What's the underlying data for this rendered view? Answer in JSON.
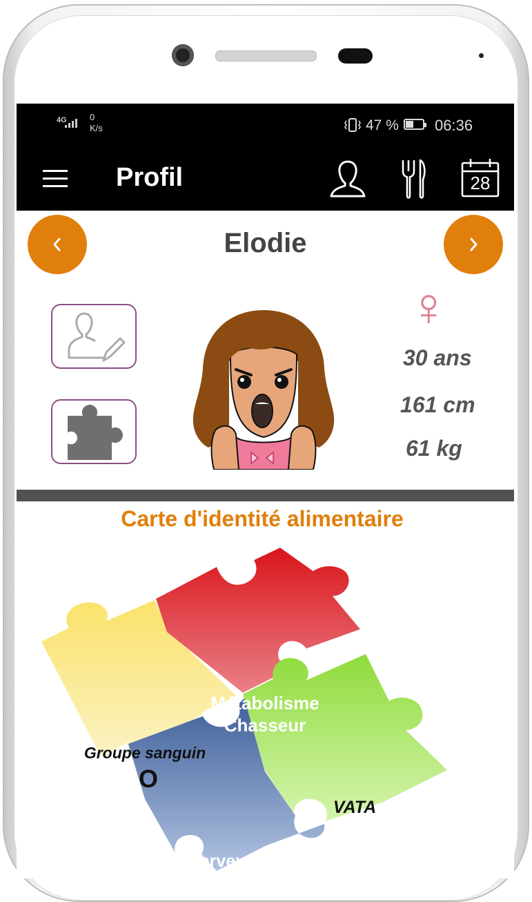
{
  "status_bar": {
    "network": "4G",
    "speed_value": "0",
    "speed_unit": "K/s",
    "battery": "47 %",
    "time": "06:36"
  },
  "app_bar": {
    "title": "Profil",
    "icons": [
      "menu-icon",
      "user-icon",
      "fork-knife-icon",
      "calendar-icon"
    ],
    "calendar_day": "28"
  },
  "profile": {
    "name": "Elodie",
    "gender_symbol": "♀",
    "age": "30 ans",
    "height": "161 cm",
    "weight": "61 kg"
  },
  "identity_card": {
    "title": "Carte d'identité alimentaire",
    "pieces": {
      "blood_group_label": "Groupe sanguin",
      "blood_group_value": "O",
      "metabolism_line1": "Métabolisme",
      "metabolism_line2": "Chasseur",
      "dosha": "VATA",
      "profile_type": "Nerveux"
    }
  },
  "colors": {
    "accent": "#e07f0b",
    "bar": "#000000",
    "divider": "#515151",
    "button_border": "#8a4f86",
    "gender": "#e07f8f"
  }
}
